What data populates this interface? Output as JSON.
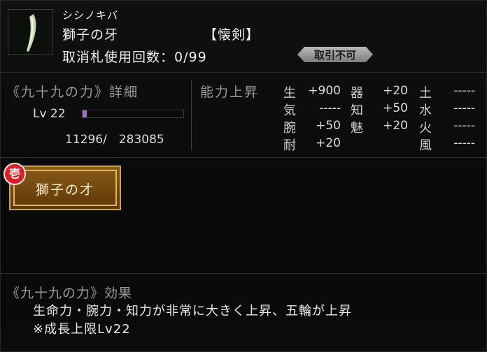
{
  "item": {
    "kana": "シシノキバ",
    "name": "獅子の牙",
    "category": "【懐剣】",
    "cancel_label": "取消札使用回数：0/99",
    "trade_badge": "取引不可",
    "icon": "fang-icon"
  },
  "detail": {
    "header": "《九十九の力》詳細",
    "level": "Lv 22",
    "exp": "11296/　283085",
    "exp_progress": 0.0399
  },
  "stats": {
    "header": "能力上昇",
    "rows": [
      {
        "k": "生",
        "v": "+900"
      },
      {
        "k": "気",
        "v": "-----"
      },
      {
        "k": "腕",
        "v": "+50"
      },
      {
        "k": "耐",
        "v": "+20"
      },
      {
        "k": "器",
        "v": "+20"
      },
      {
        "k": "知",
        "v": "+50"
      },
      {
        "k": "魅",
        "v": "+20"
      },
      {
        "k": "土",
        "v": "-----"
      },
      {
        "k": "水",
        "v": "-----"
      },
      {
        "k": "火",
        "v": "-----"
      },
      {
        "k": "風",
        "v": "-----"
      }
    ]
  },
  "skill": {
    "rank": "壱",
    "name": "獅子の才"
  },
  "effect": {
    "header": "《九十九の力》効果",
    "line1": "生命力・腕力・知力が非常に大きく上昇、五輪が上昇",
    "line2": "※成長上限Lv22"
  },
  "colors": {
    "exp_bar": "#9a6fc4",
    "slot_gold": "#c9a64a",
    "rank_red": "#d8202a"
  }
}
